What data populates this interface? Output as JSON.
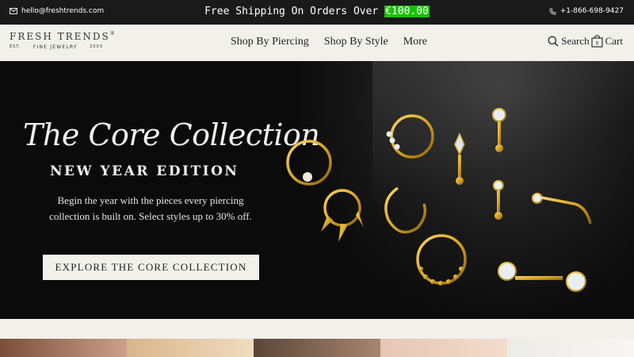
{
  "topbar": {
    "email": "hello@freshtrends.com",
    "promo_text": "Free Shipping On Orders Over ",
    "promo_amount": "€100.00",
    "phone": "+1-866-698-9427"
  },
  "logo": {
    "brand": "FRESH TRENDS",
    "registered": "®",
    "est": "EST.",
    "tagline": "FINE JEWELRY",
    "year": "2003"
  },
  "nav": {
    "items": [
      "Shop By Piercing",
      "Shop By Style",
      "More"
    ]
  },
  "header_actions": {
    "search_label": "Search",
    "cart_label": "Cart",
    "cart_count": "0"
  },
  "hero": {
    "title": "The Core Collection",
    "subtitle": "NEW YEAR EDITION",
    "body_line1": "Begin the year with the pieces every piercing",
    "body_line2": "collection is built on. Select styles up to 30% off.",
    "cta_label": "EXPLORE THE CORE COLLECTION"
  },
  "colors": {
    "topbar_bg": "#1a1a1a",
    "page_bg": "#f2f0eb",
    "hero_bg": "#0b0b0b",
    "promo_highlight": "#17c200",
    "gold": "#d9a520"
  },
  "icons": {
    "email": "envelope-icon",
    "phone": "phone-icon",
    "search": "search-icon",
    "cart": "shopping-bag-icon"
  }
}
